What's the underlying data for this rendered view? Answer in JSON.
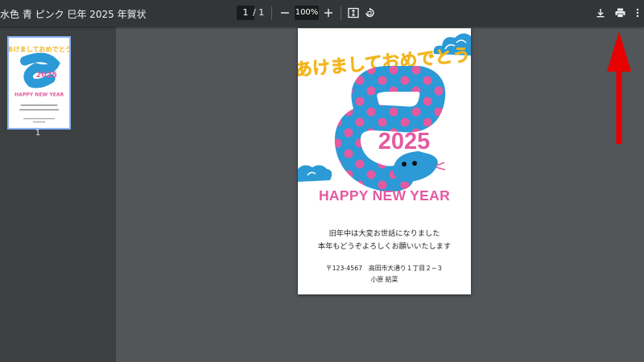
{
  "toolbar": {
    "title": "水色 青 ピンク 巳年 2025 年賀状",
    "current_page": "1",
    "page_separator": "/ 1",
    "zoom": "100%",
    "icons": [
      "minus-icon",
      "plus-icon",
      "fit-page-icon",
      "rotate-icon",
      "download-icon",
      "print-icon",
      "more-icon"
    ]
  },
  "sidebar": {
    "page_label": "1"
  },
  "card": {
    "greeting": "あけましておめでとう",
    "year": "2025",
    "happy": "HAPPY NEW YEAR",
    "line1": "旧年中は大変お世話になりました",
    "line2": "本年もどうぞよろしくお願いいたします",
    "address": "〒123-4567　高田市大通り１丁目２−３",
    "name": "小原 結菜"
  },
  "colors": {
    "toolbar_bg": "#323639",
    "sidebar_bg": "#3c4043",
    "viewer_bg": "#525659",
    "accent_yellow": "#f2b51c",
    "snake_blue": "#2b9ad6",
    "snake_pink": "#e45aa0",
    "annotation_red": "#e60000"
  }
}
